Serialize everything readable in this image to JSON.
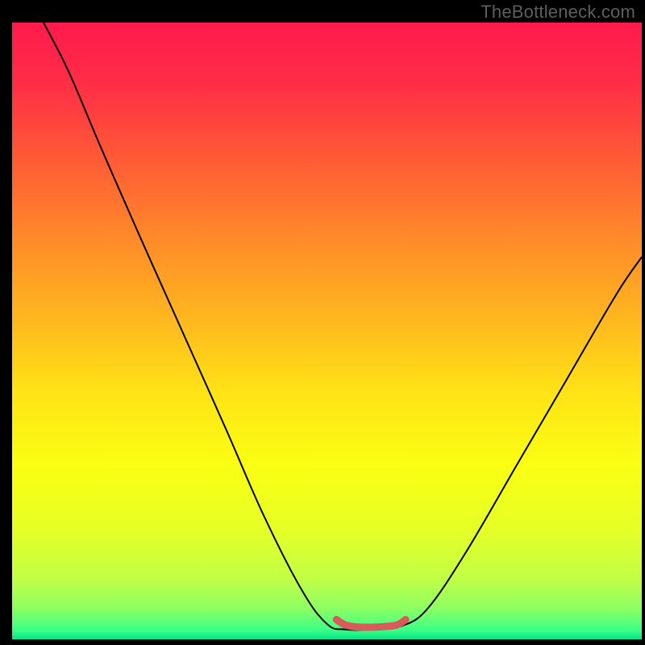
{
  "watermark": "TheBottleneck.com",
  "chart_data": {
    "type": "line",
    "title": "",
    "xlabel": "",
    "ylabel": "",
    "xlim": [
      0,
      100
    ],
    "ylim": [
      0,
      100
    ],
    "grid": false,
    "legend": false,
    "background": {
      "type": "vertical-gradient",
      "stops": [
        {
          "offset": 0.0,
          "color": "#ff1a4d"
        },
        {
          "offset": 0.1,
          "color": "#ff2e46"
        },
        {
          "offset": 0.22,
          "color": "#ff5a36"
        },
        {
          "offset": 0.35,
          "color": "#ff8a2a"
        },
        {
          "offset": 0.48,
          "color": "#ffb71f"
        },
        {
          "offset": 0.6,
          "color": "#ffe316"
        },
        {
          "offset": 0.72,
          "color": "#faff13"
        },
        {
          "offset": 0.82,
          "color": "#e6ff26"
        },
        {
          "offset": 0.9,
          "color": "#c3ff45"
        },
        {
          "offset": 0.95,
          "color": "#8dff63"
        },
        {
          "offset": 0.985,
          "color": "#3dff86"
        },
        {
          "offset": 1.0,
          "color": "#00e58a"
        }
      ]
    },
    "series": [
      {
        "name": "bottleneck-curve",
        "color": "#000000",
        "width": 2,
        "points": [
          {
            "x": 5,
            "y": 100
          },
          {
            "x": 9,
            "y": 92
          },
          {
            "x": 14,
            "y": 80
          },
          {
            "x": 20,
            "y": 66
          },
          {
            "x": 27,
            "y": 50
          },
          {
            "x": 34,
            "y": 34
          },
          {
            "x": 40,
            "y": 20
          },
          {
            "x": 46,
            "y": 8
          },
          {
            "x": 50,
            "y": 2.5
          },
          {
            "x": 53,
            "y": 1.6
          },
          {
            "x": 58,
            "y": 1.6
          },
          {
            "x": 62,
            "y": 2.2
          },
          {
            "x": 66,
            "y": 5
          },
          {
            "x": 72,
            "y": 14
          },
          {
            "x": 80,
            "y": 28
          },
          {
            "x": 88,
            "y": 42
          },
          {
            "x": 96,
            "y": 56
          },
          {
            "x": 100,
            "y": 62
          }
        ]
      },
      {
        "name": "optimal-segment",
        "color": "#d85a5a",
        "width": 9,
        "linecap": "round",
        "points": [
          {
            "x": 51.5,
            "y": 3.2
          },
          {
            "x": 53,
            "y": 2.3
          },
          {
            "x": 55,
            "y": 2.0
          },
          {
            "x": 58,
            "y": 2.0
          },
          {
            "x": 61,
            "y": 2.3
          },
          {
            "x": 62.5,
            "y": 3.2
          }
        ]
      }
    ]
  },
  "colors": {
    "page_bg": "#000000",
    "watermark_text": "#5e5e5e"
  }
}
